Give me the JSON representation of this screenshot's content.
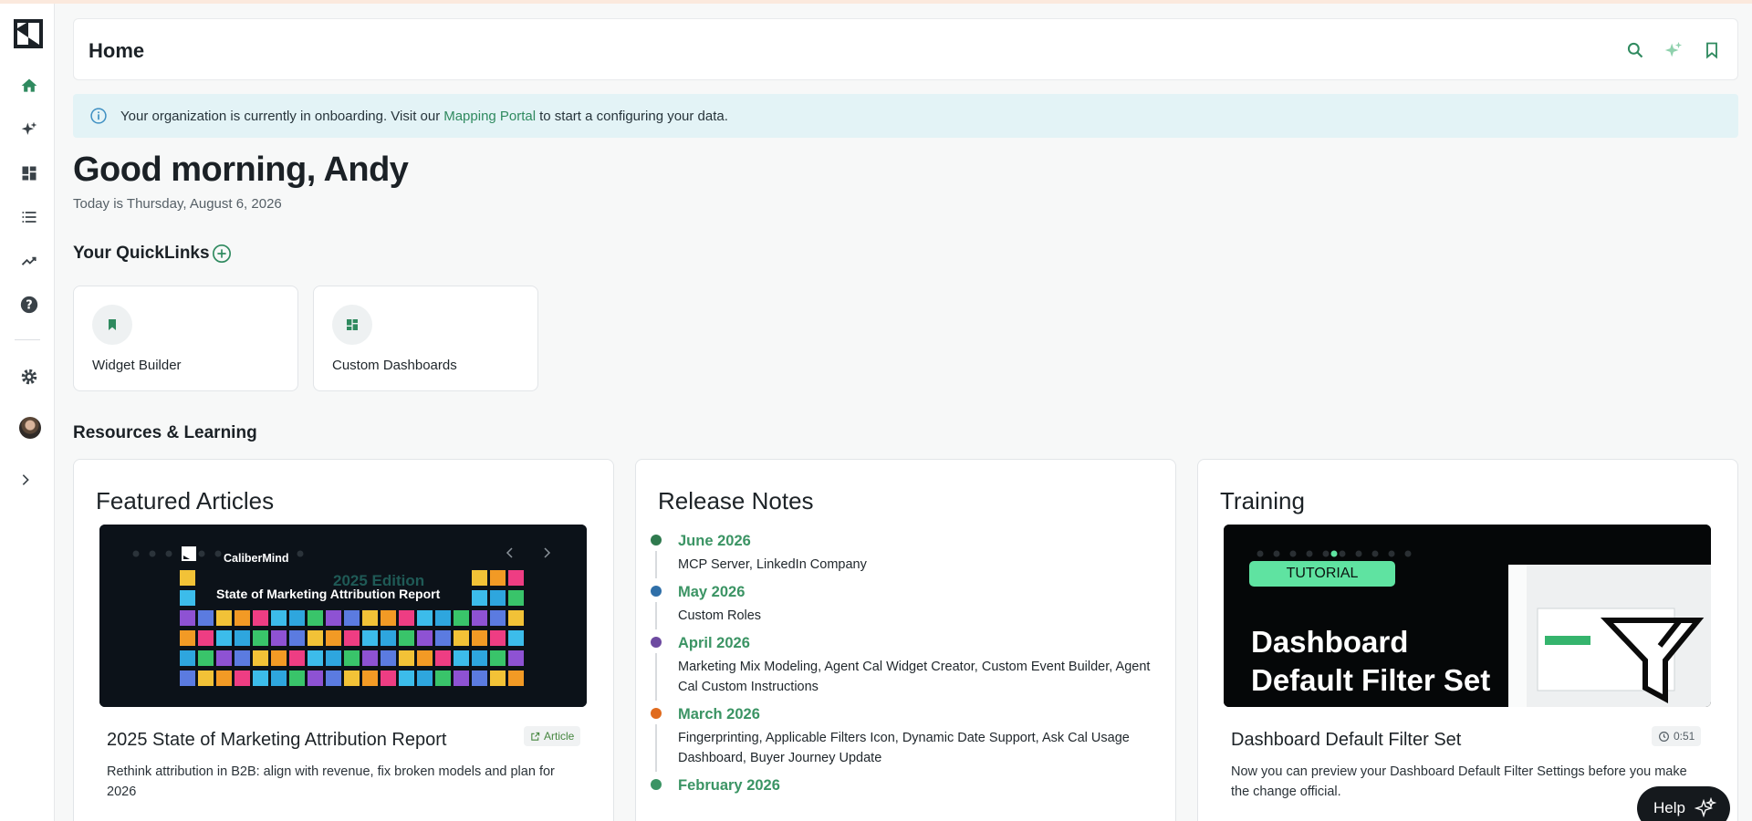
{
  "header": {
    "title": "Home"
  },
  "banner": {
    "text_before": "Your organization is currently in onboarding. Visit our",
    "link": "Mapping Portal",
    "text_after": "to start a configuring your data."
  },
  "greeting": {
    "headline": "Good morning, Andy",
    "date": "Today is Thursday, August 6, 2026"
  },
  "quicklinks": {
    "title": "Your QuickLinks",
    "items": [
      {
        "label": "Widget Builder",
        "icon": "bookmark-icon"
      },
      {
        "label": "Custom Dashboards",
        "icon": "dashboard-icon"
      }
    ]
  },
  "resources": {
    "title": "Resources & Learning",
    "featured": {
      "heading": "Featured Articles",
      "hero_brand": "CaliberMind",
      "hero_edition": "2025 Edition",
      "hero_title": "State of Marketing Attribution Report",
      "article_title": "2025 State of Marketing Attribution Report",
      "badge": "Article",
      "description": "Rethink attribution in B2B: align with revenue, fix broken models and plan for 2026"
    },
    "release_notes": {
      "heading": "Release Notes",
      "items": [
        {
          "month": "June 2026",
          "text": "MCP Server, LinkedIn Company",
          "color": "#2f7a4e"
        },
        {
          "month": "May 2026",
          "text": "Custom Roles",
          "color": "#2f6fa8"
        },
        {
          "month": "April 2026",
          "text": "Marketing Mix Modeling, Agent Cal Widget Creator, Custom Event Builder, Agent Cal Custom Instructions",
          "color": "#6d4aa0"
        },
        {
          "month": "March 2026",
          "text": "Fingerprinting, Applicable Filters Icon, Dynamic Date Support, Ask Cal Usage Dashboard, Buyer Journey Update",
          "color": "#e06b1e"
        },
        {
          "month": "February 2026",
          "text": "",
          "color": "#3b9464"
        }
      ]
    },
    "training": {
      "heading": "Training",
      "tag": "TUTORIAL",
      "hero_title_1": "Dashboard",
      "hero_title_2": "Default Filter Set",
      "video_title": "Dashboard Default Filter Set",
      "duration": "0:51",
      "description": "Now you can preview your Dashboard Default Filter Settings before you make the change official."
    }
  },
  "help": {
    "label": "Help"
  },
  "colors": {
    "accent": "#2f8a5f",
    "banner_bg": "#e3f3f6"
  }
}
